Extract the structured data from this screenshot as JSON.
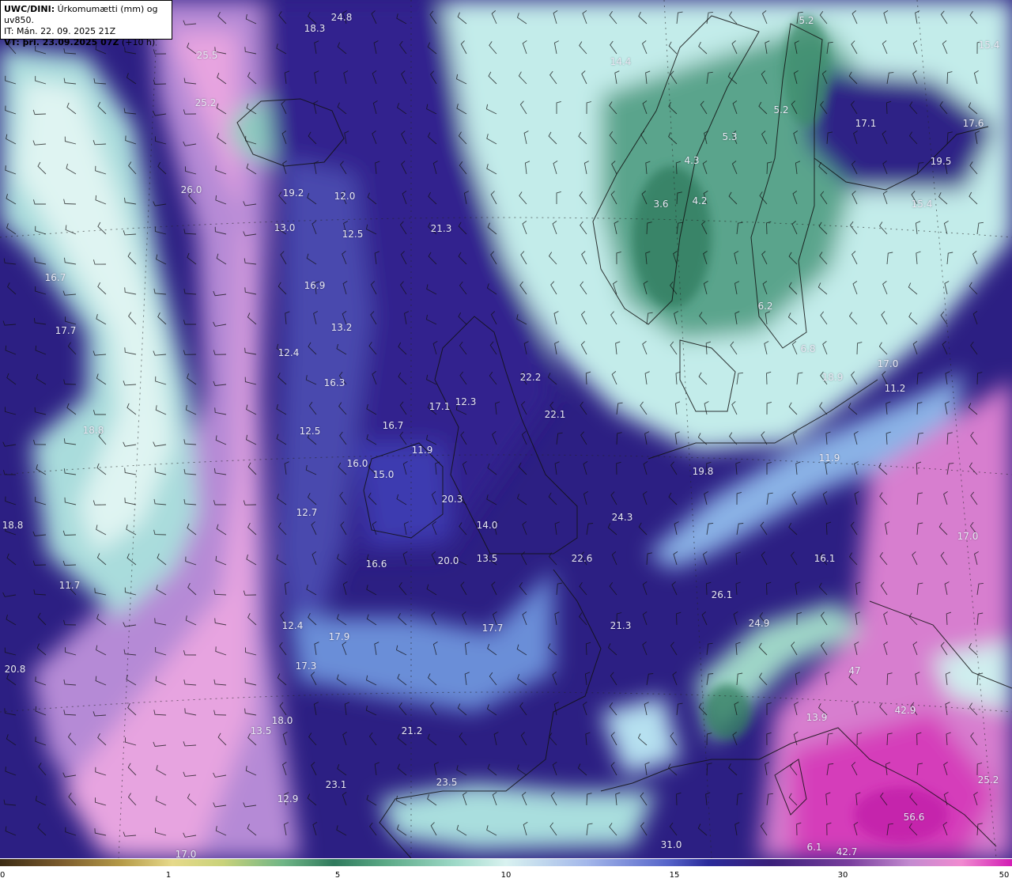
{
  "header": {
    "model": "UWC/DINI",
    "model_suffix": ":",
    "description": " Úrkomumætti (mm) og uv850.",
    "it_line": "IT: Mán. 22. 09. 2025 21Z",
    "vt_bold": "VT: þri. 23.09.2025 07Z",
    "vt_suffix": " (+10 h)"
  },
  "colorbar": {
    "ticks": [
      "0",
      "1",
      "5",
      "10",
      "15",
      "30",
      "50"
    ]
  },
  "map_labels": [
    "24.8",
    "18.3",
    "25.5",
    "25.2",
    "26.0",
    "19.2",
    "12.0",
    "13.0",
    "12.5",
    "21.3",
    "16.7",
    "16.9",
    "17.7",
    "13.2",
    "12.4",
    "16.3",
    "22.2",
    "17.1",
    "12.3",
    "22.1",
    "18.8",
    "12.5",
    "16.7",
    "11.9",
    "16.0",
    "15.0",
    "20.3",
    "12.7",
    "14.0",
    "18.8",
    "11.7",
    "16.6",
    "20.0",
    "13.5",
    "22.6",
    "24.3",
    "19.8",
    "12.4",
    "17.9",
    "17.7",
    "21.3",
    "17.3",
    "20.8",
    "18.0",
    "13.5",
    "21.2",
    "23.1",
    "23.5",
    "12.9",
    "17.0",
    "5.2",
    "15.4",
    "14.4",
    "17.1",
    "17.6",
    "5.2",
    "5.3",
    "4.3",
    "19.5",
    "15.4",
    "3.6",
    "4.2",
    "6.2",
    "6.8",
    "18.9",
    "17.0",
    "11.2",
    "11.9",
    "16.1",
    "17.0",
    "26.1",
    "24.9",
    "47",
    "42.9",
    "13.9",
    "56.6",
    "25.2",
    "42.7",
    "31.0",
    "6.1"
  ]
}
